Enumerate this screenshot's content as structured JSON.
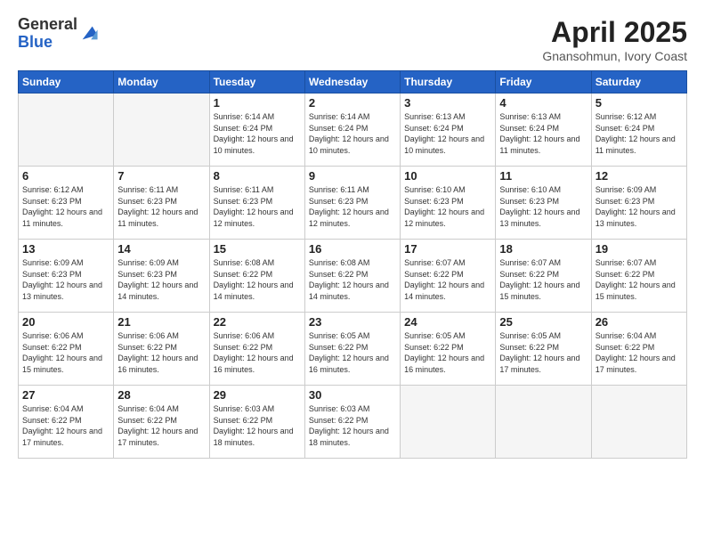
{
  "logo": {
    "general": "General",
    "blue": "Blue"
  },
  "header": {
    "title": "April 2025",
    "subtitle": "Gnansohmun, Ivory Coast"
  },
  "weekdays": [
    "Sunday",
    "Monday",
    "Tuesday",
    "Wednesday",
    "Thursday",
    "Friday",
    "Saturday"
  ],
  "days": [
    {
      "num": "",
      "sunrise": "",
      "sunset": "",
      "daylight": "",
      "empty": true
    },
    {
      "num": "",
      "sunrise": "",
      "sunset": "",
      "daylight": "",
      "empty": true
    },
    {
      "num": "1",
      "sunrise": "Sunrise: 6:14 AM",
      "sunset": "Sunset: 6:24 PM",
      "daylight": "Daylight: 12 hours and 10 minutes."
    },
    {
      "num": "2",
      "sunrise": "Sunrise: 6:14 AM",
      "sunset": "Sunset: 6:24 PM",
      "daylight": "Daylight: 12 hours and 10 minutes."
    },
    {
      "num": "3",
      "sunrise": "Sunrise: 6:13 AM",
      "sunset": "Sunset: 6:24 PM",
      "daylight": "Daylight: 12 hours and 10 minutes."
    },
    {
      "num": "4",
      "sunrise": "Sunrise: 6:13 AM",
      "sunset": "Sunset: 6:24 PM",
      "daylight": "Daylight: 12 hours and 11 minutes."
    },
    {
      "num": "5",
      "sunrise": "Sunrise: 6:12 AM",
      "sunset": "Sunset: 6:24 PM",
      "daylight": "Daylight: 12 hours and 11 minutes."
    },
    {
      "num": "6",
      "sunrise": "Sunrise: 6:12 AM",
      "sunset": "Sunset: 6:23 PM",
      "daylight": "Daylight: 12 hours and 11 minutes."
    },
    {
      "num": "7",
      "sunrise": "Sunrise: 6:11 AM",
      "sunset": "Sunset: 6:23 PM",
      "daylight": "Daylight: 12 hours and 11 minutes."
    },
    {
      "num": "8",
      "sunrise": "Sunrise: 6:11 AM",
      "sunset": "Sunset: 6:23 PM",
      "daylight": "Daylight: 12 hours and 12 minutes."
    },
    {
      "num": "9",
      "sunrise": "Sunrise: 6:11 AM",
      "sunset": "Sunset: 6:23 PM",
      "daylight": "Daylight: 12 hours and 12 minutes."
    },
    {
      "num": "10",
      "sunrise": "Sunrise: 6:10 AM",
      "sunset": "Sunset: 6:23 PM",
      "daylight": "Daylight: 12 hours and 12 minutes."
    },
    {
      "num": "11",
      "sunrise": "Sunrise: 6:10 AM",
      "sunset": "Sunset: 6:23 PM",
      "daylight": "Daylight: 12 hours and 13 minutes."
    },
    {
      "num": "12",
      "sunrise": "Sunrise: 6:09 AM",
      "sunset": "Sunset: 6:23 PM",
      "daylight": "Daylight: 12 hours and 13 minutes."
    },
    {
      "num": "13",
      "sunrise": "Sunrise: 6:09 AM",
      "sunset": "Sunset: 6:23 PM",
      "daylight": "Daylight: 12 hours and 13 minutes."
    },
    {
      "num": "14",
      "sunrise": "Sunrise: 6:09 AM",
      "sunset": "Sunset: 6:23 PM",
      "daylight": "Daylight: 12 hours and 14 minutes."
    },
    {
      "num": "15",
      "sunrise": "Sunrise: 6:08 AM",
      "sunset": "Sunset: 6:22 PM",
      "daylight": "Daylight: 12 hours and 14 minutes."
    },
    {
      "num": "16",
      "sunrise": "Sunrise: 6:08 AM",
      "sunset": "Sunset: 6:22 PM",
      "daylight": "Daylight: 12 hours and 14 minutes."
    },
    {
      "num": "17",
      "sunrise": "Sunrise: 6:07 AM",
      "sunset": "Sunset: 6:22 PM",
      "daylight": "Daylight: 12 hours and 14 minutes."
    },
    {
      "num": "18",
      "sunrise": "Sunrise: 6:07 AM",
      "sunset": "Sunset: 6:22 PM",
      "daylight": "Daylight: 12 hours and 15 minutes."
    },
    {
      "num": "19",
      "sunrise": "Sunrise: 6:07 AM",
      "sunset": "Sunset: 6:22 PM",
      "daylight": "Daylight: 12 hours and 15 minutes."
    },
    {
      "num": "20",
      "sunrise": "Sunrise: 6:06 AM",
      "sunset": "Sunset: 6:22 PM",
      "daylight": "Daylight: 12 hours and 15 minutes."
    },
    {
      "num": "21",
      "sunrise": "Sunrise: 6:06 AM",
      "sunset": "Sunset: 6:22 PM",
      "daylight": "Daylight: 12 hours and 16 minutes."
    },
    {
      "num": "22",
      "sunrise": "Sunrise: 6:06 AM",
      "sunset": "Sunset: 6:22 PM",
      "daylight": "Daylight: 12 hours and 16 minutes."
    },
    {
      "num": "23",
      "sunrise": "Sunrise: 6:05 AM",
      "sunset": "Sunset: 6:22 PM",
      "daylight": "Daylight: 12 hours and 16 minutes."
    },
    {
      "num": "24",
      "sunrise": "Sunrise: 6:05 AM",
      "sunset": "Sunset: 6:22 PM",
      "daylight": "Daylight: 12 hours and 16 minutes."
    },
    {
      "num": "25",
      "sunrise": "Sunrise: 6:05 AM",
      "sunset": "Sunset: 6:22 PM",
      "daylight": "Daylight: 12 hours and 17 minutes."
    },
    {
      "num": "26",
      "sunrise": "Sunrise: 6:04 AM",
      "sunset": "Sunset: 6:22 PM",
      "daylight": "Daylight: 12 hours and 17 minutes."
    },
    {
      "num": "27",
      "sunrise": "Sunrise: 6:04 AM",
      "sunset": "Sunset: 6:22 PM",
      "daylight": "Daylight: 12 hours and 17 minutes."
    },
    {
      "num": "28",
      "sunrise": "Sunrise: 6:04 AM",
      "sunset": "Sunset: 6:22 PM",
      "daylight": "Daylight: 12 hours and 17 minutes."
    },
    {
      "num": "29",
      "sunrise": "Sunrise: 6:03 AM",
      "sunset": "Sunset: 6:22 PM",
      "daylight": "Daylight: 12 hours and 18 minutes."
    },
    {
      "num": "30",
      "sunrise": "Sunrise: 6:03 AM",
      "sunset": "Sunset: 6:22 PM",
      "daylight": "Daylight: 12 hours and 18 minutes."
    },
    {
      "num": "",
      "sunrise": "",
      "sunset": "",
      "daylight": "",
      "empty": true
    },
    {
      "num": "",
      "sunrise": "",
      "sunset": "",
      "daylight": "",
      "empty": true
    },
    {
      "num": "",
      "sunrise": "",
      "sunset": "",
      "daylight": "",
      "empty": true
    }
  ]
}
